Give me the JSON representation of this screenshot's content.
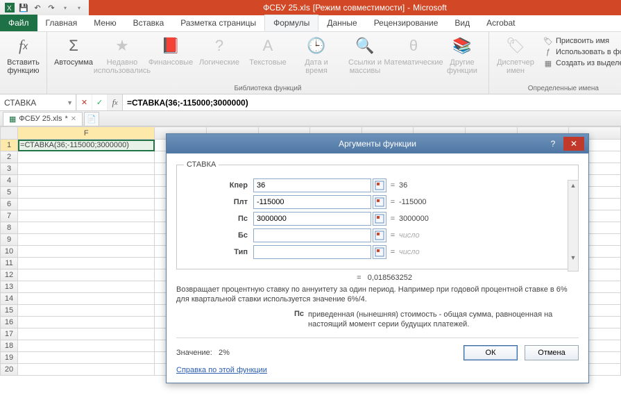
{
  "title": {
    "filename": "ФСБУ 25.xls",
    "mode": "[Режим совместимости]",
    "app": "Microsoft"
  },
  "qat": {
    "save": "save-icon",
    "undo": "undo-icon",
    "redo": "redo-icon"
  },
  "tabs": {
    "file": "Файл",
    "list": [
      "Главная",
      "Меню",
      "Вставка",
      "Разметка страницы",
      "Формулы",
      "Данные",
      "Рецензирование",
      "Вид",
      "Acrobat"
    ],
    "activeIndex": 4
  },
  "ribbon": {
    "insertfn": {
      "label": "Вставить функцию",
      "glyph": "fx"
    },
    "autosum": {
      "label": "Автосумма",
      "glyph": "Σ"
    },
    "recent": {
      "label": "Недавно использовались",
      "dim": true
    },
    "financial": {
      "label": "Финансовые",
      "dim": true
    },
    "logical": {
      "label": "Логические",
      "dim": true
    },
    "text": {
      "label": "Текстовые",
      "dim": true
    },
    "datetime": {
      "label": "Дата и время",
      "dim": true
    },
    "lookup": {
      "label": "Ссылки и массивы",
      "dim": true
    },
    "math": {
      "label": "Математические",
      "dim": true
    },
    "more": {
      "label": "Другие функции",
      "dim": true
    },
    "library_label": "Библиотека функций",
    "namemgr": {
      "label": "Диспетчер имен",
      "dim": true
    },
    "definename": "Присвоить имя",
    "useinformula": "Использовать в фор",
    "createfromsel": "Создать из выделенн",
    "definednames_label": "Определенные имена"
  },
  "formulabar": {
    "name": "СТАВКА",
    "formula": "=СТАВКА(36;-115000;3000000)"
  },
  "doctab": {
    "name": "ФСБУ 25.xls",
    "dirty": "*"
  },
  "cell": {
    "value": "=СТАВКА(36;-115000;3000000)"
  },
  "columns": [
    "F"
  ],
  "dialog": {
    "title": "Аргументы функции",
    "fn": "СТАВКА",
    "args": [
      {
        "name": "Кпер",
        "value": "36",
        "result": "36"
      },
      {
        "name": "Плт",
        "value": "-115000",
        "result": "-115000"
      },
      {
        "name": "Пс",
        "value": "3000000",
        "result": "3000000"
      },
      {
        "name": "Бс",
        "value": "",
        "result": "число",
        "dim": true
      },
      {
        "name": "Тип",
        "value": "",
        "result": "число",
        "dim": true
      }
    ],
    "fnresult_prefix": "=",
    "fnresult": "0,018563252",
    "description": "Возвращает процентную ставку по аннуитету за один период. Например при годовой процентной ставке в 6% для квартальной ставки используется значение 6%/4.",
    "argname": "Пс",
    "argdesc": "приведенная (нынешняя) стоимость - общая сумма, равноценная на настоящий момент серии будущих платежей.",
    "value_label": "Значение:",
    "value": "2%",
    "helplink": "Справка по этой функции",
    "ok": "ОК",
    "cancel": "Отмена"
  }
}
